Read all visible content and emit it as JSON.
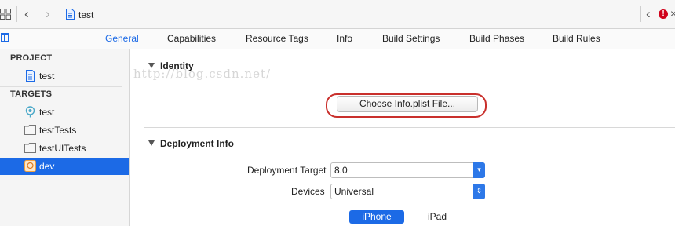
{
  "toolbar": {
    "title": "test",
    "error_badge": "!",
    "close_glyph": "×",
    "back_glyph": "‹",
    "forward_glyph": "›",
    "related_back_glyph": "‹",
    "icons": [
      "grid-icon",
      "chevron-left-icon",
      "chevron-right-icon",
      "swift-file-icon",
      "error-icon",
      "close-icon"
    ]
  },
  "tabs": [
    "General",
    "Capabilities",
    "Resource Tags",
    "Info",
    "Build Settings",
    "Build Phases",
    "Build Rules"
  ],
  "active_tab": "General",
  "sidebar": {
    "project_header": "PROJECT",
    "project_items": [
      {
        "label": "test",
        "icon": "project-file-icon"
      }
    ],
    "targets_header": "TARGETS",
    "target_items": [
      {
        "label": "test",
        "icon": "app-target-icon",
        "selected": false
      },
      {
        "label": "testTests",
        "icon": "folder-icon",
        "selected": false
      },
      {
        "label": "testUITests",
        "icon": "folder-icon",
        "selected": false
      },
      {
        "label": "dev",
        "icon": "app-target-icon",
        "selected": true
      }
    ]
  },
  "identity": {
    "title": "Identity",
    "choose_plist_label": "Choose Info.plist File..."
  },
  "watermark": "http://blog.csdn.net/",
  "deployment": {
    "title": "Deployment Info",
    "target_label": "Deployment Target",
    "target_value": "8.0",
    "devices_label": "Devices",
    "devices_value": "Universal",
    "segments": [
      "iPhone",
      "iPad"
    ],
    "selected_segment": "iPhone"
  },
  "colors": {
    "accent": "#1c6ae6",
    "highlight_ring": "#c9302c",
    "error": "#d0021b"
  }
}
